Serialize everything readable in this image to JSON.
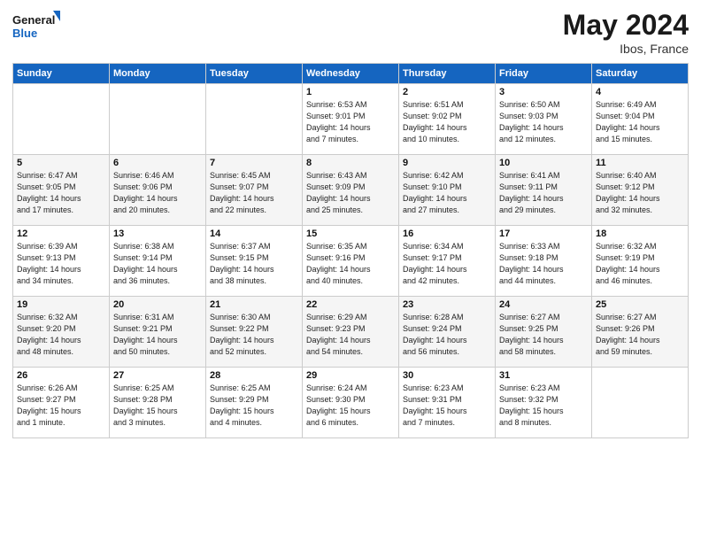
{
  "header": {
    "logo_general": "General",
    "logo_blue": "Blue",
    "month_year": "May 2024",
    "location": "Ibos, France"
  },
  "weekdays": [
    "Sunday",
    "Monday",
    "Tuesday",
    "Wednesday",
    "Thursday",
    "Friday",
    "Saturday"
  ],
  "weeks": [
    [
      {
        "day": "",
        "info": ""
      },
      {
        "day": "",
        "info": ""
      },
      {
        "day": "",
        "info": ""
      },
      {
        "day": "1",
        "info": "Sunrise: 6:53 AM\nSunset: 9:01 PM\nDaylight: 14 hours\nand 7 minutes."
      },
      {
        "day": "2",
        "info": "Sunrise: 6:51 AM\nSunset: 9:02 PM\nDaylight: 14 hours\nand 10 minutes."
      },
      {
        "day": "3",
        "info": "Sunrise: 6:50 AM\nSunset: 9:03 PM\nDaylight: 14 hours\nand 12 minutes."
      },
      {
        "day": "4",
        "info": "Sunrise: 6:49 AM\nSunset: 9:04 PM\nDaylight: 14 hours\nand 15 minutes."
      }
    ],
    [
      {
        "day": "5",
        "info": "Sunrise: 6:47 AM\nSunset: 9:05 PM\nDaylight: 14 hours\nand 17 minutes."
      },
      {
        "day": "6",
        "info": "Sunrise: 6:46 AM\nSunset: 9:06 PM\nDaylight: 14 hours\nand 20 minutes."
      },
      {
        "day": "7",
        "info": "Sunrise: 6:45 AM\nSunset: 9:07 PM\nDaylight: 14 hours\nand 22 minutes."
      },
      {
        "day": "8",
        "info": "Sunrise: 6:43 AM\nSunset: 9:09 PM\nDaylight: 14 hours\nand 25 minutes."
      },
      {
        "day": "9",
        "info": "Sunrise: 6:42 AM\nSunset: 9:10 PM\nDaylight: 14 hours\nand 27 minutes."
      },
      {
        "day": "10",
        "info": "Sunrise: 6:41 AM\nSunset: 9:11 PM\nDaylight: 14 hours\nand 29 minutes."
      },
      {
        "day": "11",
        "info": "Sunrise: 6:40 AM\nSunset: 9:12 PM\nDaylight: 14 hours\nand 32 minutes."
      }
    ],
    [
      {
        "day": "12",
        "info": "Sunrise: 6:39 AM\nSunset: 9:13 PM\nDaylight: 14 hours\nand 34 minutes."
      },
      {
        "day": "13",
        "info": "Sunrise: 6:38 AM\nSunset: 9:14 PM\nDaylight: 14 hours\nand 36 minutes."
      },
      {
        "day": "14",
        "info": "Sunrise: 6:37 AM\nSunset: 9:15 PM\nDaylight: 14 hours\nand 38 minutes."
      },
      {
        "day": "15",
        "info": "Sunrise: 6:35 AM\nSunset: 9:16 PM\nDaylight: 14 hours\nand 40 minutes."
      },
      {
        "day": "16",
        "info": "Sunrise: 6:34 AM\nSunset: 9:17 PM\nDaylight: 14 hours\nand 42 minutes."
      },
      {
        "day": "17",
        "info": "Sunrise: 6:33 AM\nSunset: 9:18 PM\nDaylight: 14 hours\nand 44 minutes."
      },
      {
        "day": "18",
        "info": "Sunrise: 6:32 AM\nSunset: 9:19 PM\nDaylight: 14 hours\nand 46 minutes."
      }
    ],
    [
      {
        "day": "19",
        "info": "Sunrise: 6:32 AM\nSunset: 9:20 PM\nDaylight: 14 hours\nand 48 minutes."
      },
      {
        "day": "20",
        "info": "Sunrise: 6:31 AM\nSunset: 9:21 PM\nDaylight: 14 hours\nand 50 minutes."
      },
      {
        "day": "21",
        "info": "Sunrise: 6:30 AM\nSunset: 9:22 PM\nDaylight: 14 hours\nand 52 minutes."
      },
      {
        "day": "22",
        "info": "Sunrise: 6:29 AM\nSunset: 9:23 PM\nDaylight: 14 hours\nand 54 minutes."
      },
      {
        "day": "23",
        "info": "Sunrise: 6:28 AM\nSunset: 9:24 PM\nDaylight: 14 hours\nand 56 minutes."
      },
      {
        "day": "24",
        "info": "Sunrise: 6:27 AM\nSunset: 9:25 PM\nDaylight: 14 hours\nand 58 minutes."
      },
      {
        "day": "25",
        "info": "Sunrise: 6:27 AM\nSunset: 9:26 PM\nDaylight: 14 hours\nand 59 minutes."
      }
    ],
    [
      {
        "day": "26",
        "info": "Sunrise: 6:26 AM\nSunset: 9:27 PM\nDaylight: 15 hours\nand 1 minute."
      },
      {
        "day": "27",
        "info": "Sunrise: 6:25 AM\nSunset: 9:28 PM\nDaylight: 15 hours\nand 3 minutes."
      },
      {
        "day": "28",
        "info": "Sunrise: 6:25 AM\nSunset: 9:29 PM\nDaylight: 15 hours\nand 4 minutes."
      },
      {
        "day": "29",
        "info": "Sunrise: 6:24 AM\nSunset: 9:30 PM\nDaylight: 15 hours\nand 6 minutes."
      },
      {
        "day": "30",
        "info": "Sunrise: 6:23 AM\nSunset: 9:31 PM\nDaylight: 15 hours\nand 7 minutes."
      },
      {
        "day": "31",
        "info": "Sunrise: 6:23 AM\nSunset: 9:32 PM\nDaylight: 15 hours\nand 8 minutes."
      },
      {
        "day": "",
        "info": ""
      }
    ]
  ]
}
